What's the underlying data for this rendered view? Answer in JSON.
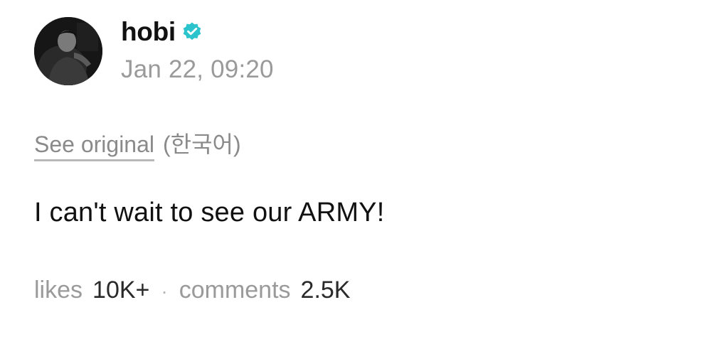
{
  "author": {
    "name": "hobi",
    "verified": true,
    "verified_color": "#2bc4cc",
    "avatar": "profile-photo"
  },
  "post": {
    "timestamp": "Jan 22, 09:20",
    "see_original_label": "See original",
    "original_language": "(한국어)",
    "body": "I can't wait to see our ARMY!"
  },
  "stats": {
    "likes_label": "likes",
    "likes_value": "10K+",
    "separator": "·",
    "comments_label": "comments",
    "comments_value": "2.5K"
  }
}
